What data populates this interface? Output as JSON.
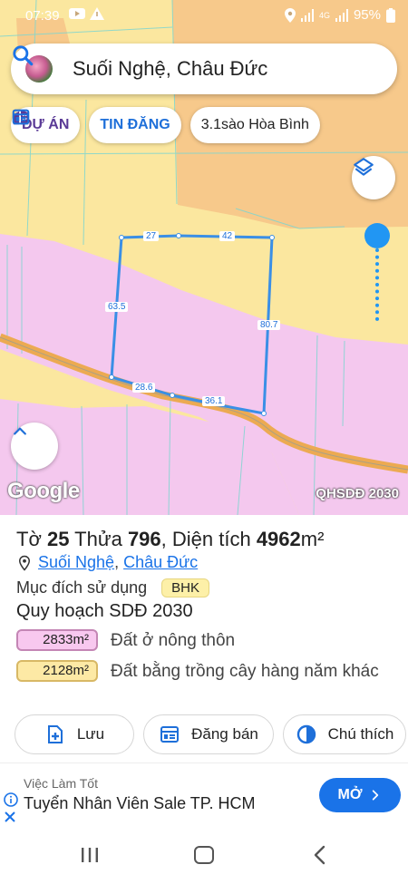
{
  "status_bar": {
    "time": "07:39",
    "battery": "95%",
    "network": "4G"
  },
  "search": {
    "query": "Suối Nghệ, Châu Đức"
  },
  "chips": [
    {
      "label": "DỰ ÁN"
    },
    {
      "label": "TIN ĐĂNG"
    },
    {
      "label": "3.1sào Hòa Bình"
    }
  ],
  "map": {
    "google_label": "Google",
    "layer_label": "QHSDĐ 2030",
    "edge_lengths": [
      "27",
      "42",
      "63.5",
      "80.7",
      "28.6",
      "36.1"
    ],
    "colors": {
      "residential": "#f4c8ee",
      "agri": "#fbe79f",
      "orange": "#f7c98b",
      "boundary": "#3a8fe6",
      "road": "#ecaa52"
    }
  },
  "parcel": {
    "sheet_prefix": "Tờ ",
    "sheet_no": "25",
    "parcel_prefix": " Thửa ",
    "parcel_no": "796",
    "area_prefix": ", Diện tích ",
    "area": "4962",
    "area_unit": "m²",
    "commune": "Suối Nghệ",
    "separator": ", ",
    "district": "Châu Đức",
    "purpose_label": "Mục đích sử dụng",
    "purpose_code": "BHK",
    "plan_title": "Quy hoạch SDĐ 2030",
    "plans": [
      {
        "area": "2833m²",
        "desc": "Đất ở nông thôn"
      },
      {
        "area": "2128m²",
        "desc": "Đất bằng trồng cây hàng năm khác"
      }
    ]
  },
  "actions": {
    "save": "Lưu",
    "sell": "Đăng bán",
    "legend": "Chú thích"
  },
  "ad": {
    "sponsor": "Việc Làm Tốt",
    "title": "Tuyển Nhân Viên Sale TP. HCM",
    "cta": "MỞ"
  }
}
